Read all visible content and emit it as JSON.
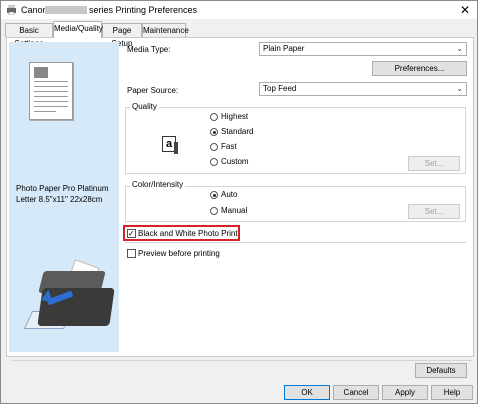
{
  "window": {
    "title_prefix": "Canon",
    "title_suffix": "series Printing Preferences",
    "close_label": "✕"
  },
  "tabs": [
    {
      "label": "Basic Settings"
    },
    {
      "label": "Media/Quality"
    },
    {
      "label": "Page Setup"
    },
    {
      "label": "Maintenance"
    }
  ],
  "preview": {
    "media_line1": "Photo Paper Pro Platinum",
    "media_line2": "Letter 8.5\"x11\" 22x28cm"
  },
  "media_type": {
    "label": "Media Type:",
    "value": "Plain Paper"
  },
  "preferences_button": "Preferences...",
  "paper_source": {
    "label": "Paper Source:",
    "value": "Top Feed"
  },
  "quality": {
    "title": "Quality",
    "icon_glyph": "a",
    "options": [
      "Highest",
      "Standard",
      "Fast",
      "Custom"
    ],
    "selected": "Standard",
    "set_button": "Set..."
  },
  "color_intensity": {
    "title": "Color/Intensity",
    "options": [
      "Auto",
      "Manual"
    ],
    "selected": "Auto",
    "set_button": "Set..."
  },
  "bw_photo_print": {
    "label": "Black and White Photo Print",
    "checked": true
  },
  "preview_before_printing": {
    "label": "Preview before printing",
    "checked": false
  },
  "buttons": {
    "defaults": "Defaults",
    "ok": "OK",
    "cancel": "Cancel",
    "apply": "Apply",
    "help": "Help"
  },
  "colors": {
    "highlight": "#d6222a",
    "preview_bg": "#d6e9f8",
    "arrow": "#2d6fd1"
  }
}
